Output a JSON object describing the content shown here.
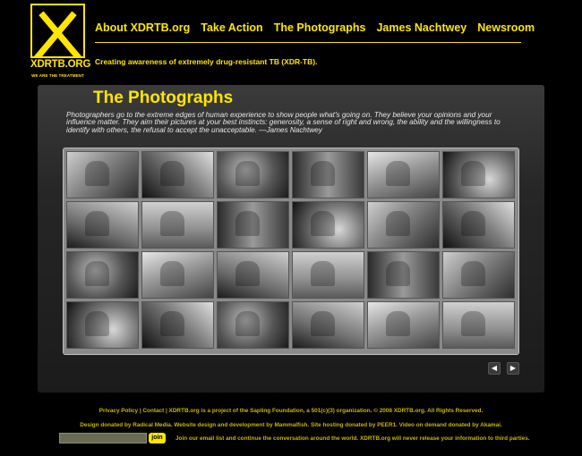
{
  "logo": {
    "letter": "X",
    "word": "XDRTB.ORG",
    "tagline": "WE ARE THE TREATMENT"
  },
  "nav": {
    "items": [
      {
        "label": "About XDRTB.org"
      },
      {
        "label": "Take Action"
      },
      {
        "label": "The Photographs"
      },
      {
        "label": "James Nachtwey"
      },
      {
        "label": "Newsroom"
      }
    ]
  },
  "header": {
    "tagline": "Creating awareness of extremely drug-resistant TB (XDR-TB)."
  },
  "main": {
    "title": "The Photographs",
    "quote": "Photographers go to the extreme edges of human experience to show people what's going on. They believe your opinions and your influence matter. They aim their pictures at your best instincts: generosity, a sense of right and wrong, the ability and the willingness to identify with others, the refusal to accept the unacceptable. —James Nachtwey",
    "gallery": {
      "prev_icon": "◀",
      "next_icon": "▶"
    }
  },
  "footer": {
    "line1": "Privacy Policy | Contact | XDRTB.org is a project of the Sapling Foundation, a 501(c)(3) organization. © 2008 XDRTB.org. All Rights Reserved.",
    "line2": "Design donated by Radical Media. Website design and development by Mammalfish. Site hosting donated by PEER1. Video on demand donated by Akamai.",
    "email_value": "",
    "join_label": "join",
    "join_text": "Join our email list and continue the conversation around the world.  XDRTB.org will never release your information to third parties."
  },
  "colors": {
    "accent": "#ffe600",
    "background": "#000000"
  }
}
